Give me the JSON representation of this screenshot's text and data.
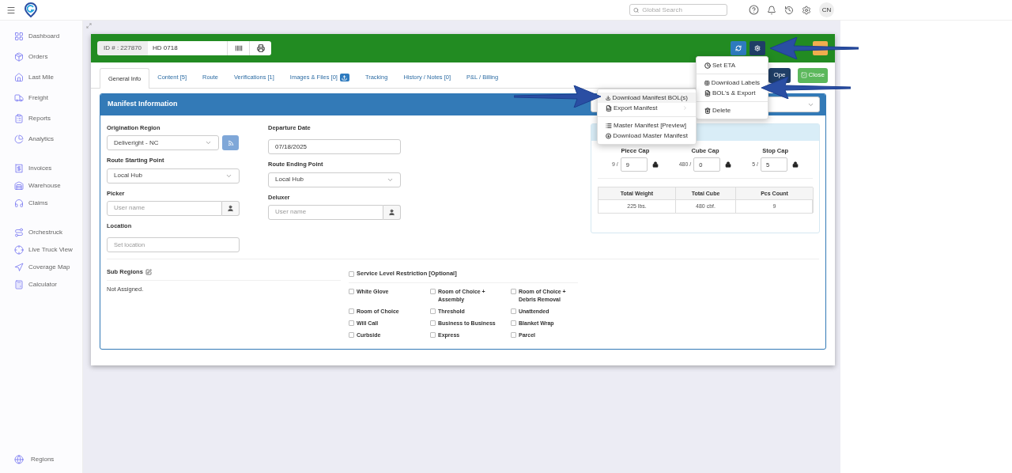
{
  "top_bar": {
    "search": {
      "placeholder": "Global Search"
    },
    "avatar": "CN"
  },
  "sidebar": {
    "groups": [
      [
        {
          "label": "Dashboard"
        },
        {
          "label": "Orders"
        },
        {
          "label": "Last Mile"
        },
        {
          "label": "Freight"
        },
        {
          "label": "Reports"
        },
        {
          "label": "Analytics"
        }
      ],
      [
        {
          "label": "Invoices"
        },
        {
          "label": "Warehouse"
        },
        {
          "label": "Claims"
        }
      ],
      [
        {
          "label": "Orchestruck"
        },
        {
          "label": "Live Truck View"
        },
        {
          "label": "Coverage Map"
        },
        {
          "label": "Calculator"
        }
      ]
    ],
    "footer": {
      "label": "Regions"
    }
  },
  "manifest": {
    "id_label": "ID # : 227870",
    "name": "HD 0718"
  },
  "tabs": [
    {
      "label": "General Info",
      "selected": true,
      "upload_button": false
    },
    {
      "label": "Content [5]",
      "selected": false,
      "upload_button": false
    },
    {
      "label": "Route",
      "selected": false,
      "upload_button": false
    },
    {
      "label": "Verifications [1]",
      "selected": false,
      "upload_button": false
    },
    {
      "label": "Images & Files [0]",
      "selected": false,
      "upload_button": true
    },
    {
      "label": "Tracking",
      "selected": false,
      "upload_button": false
    },
    {
      "label": "History / Notes [0]",
      "selected": false,
      "upload_button": false
    },
    {
      "label": "P&L / Billing",
      "selected": false,
      "upload_button": false
    }
  ],
  "actions": {
    "open_button": "Ope",
    "close_button": "Close"
  },
  "panel": {
    "title": "Manifest Information",
    "origination_region": {
      "label": "Origination Region",
      "value": "Deliveright - NC"
    },
    "departure_date": {
      "label": "Departure Date",
      "value": "07/18/2025"
    },
    "route_start": {
      "label": "Route Starting Point",
      "value": "Local Hub"
    },
    "route_end": {
      "label": "Route Ending Point",
      "value": "Local Hub"
    },
    "picker": {
      "label": "Picker",
      "placeholder": "User name"
    },
    "deluxer": {
      "label": "Deluxer",
      "placeholder": "User name"
    },
    "location": {
      "label": "Location",
      "placeholder": "Set location"
    },
    "caps": [
      {
        "label": "Piece Cap",
        "used": "9 /",
        "value": "9"
      },
      {
        "label": "Cube Cap",
        "used": "480 /",
        "value": "0"
      },
      {
        "label": "Stop Cap",
        "used": "5 /",
        "value": "5"
      }
    ],
    "totals": {
      "columns": [
        "Total Weight",
        "Total Cube",
        "Pcs Count"
      ],
      "row": [
        "225 lbs.",
        "480 cbf.",
        "9"
      ]
    },
    "sub_regions": {
      "label": "Sub Regions",
      "value": "Not Assigned."
    },
    "service_level": {
      "label": "Service Level Restriction [Optional]",
      "checked": false,
      "options": [
        {
          "label": "White Glove",
          "checked": false
        },
        {
          "label": "Room of Choice + Assembly",
          "checked": false
        },
        {
          "label": "Room of Choice + Debris Removal",
          "checked": false
        },
        {
          "label": "Room of Choice",
          "checked": false
        },
        {
          "label": "Threshold",
          "checked": false
        },
        {
          "label": "Unattended",
          "checked": false
        },
        {
          "label": "Will Call",
          "checked": false
        },
        {
          "label": "Business to Business",
          "checked": false
        },
        {
          "label": "Blanket Wrap",
          "checked": false
        },
        {
          "label": "Curbside",
          "checked": false
        },
        {
          "label": "Express",
          "checked": false
        },
        {
          "label": "Parcel",
          "checked": false
        }
      ]
    }
  },
  "gear_menu": {
    "groups": [
      [
        {
          "label": "Set ETA",
          "submenu": false,
          "selected": false
        }
      ],
      [
        {
          "label": "Download Labels",
          "submenu": false,
          "selected": false
        },
        {
          "label": "BOL's & Export",
          "submenu": false,
          "selected": false
        }
      ],
      [
        {
          "label": "Delete",
          "submenu": false,
          "selected": false
        }
      ]
    ]
  },
  "export_menu": {
    "groups": [
      [
        {
          "label": "Download Manifest BOL(s)",
          "submenu": false,
          "selected": true
        },
        {
          "label": "Export Manifest",
          "submenu": true,
          "selected": false
        }
      ],
      [
        {
          "label": "Master Manifest [Preview]",
          "submenu": false,
          "selected": false
        },
        {
          "label": "Download Master Manifest",
          "submenu": false,
          "selected": false
        }
      ]
    ]
  }
}
